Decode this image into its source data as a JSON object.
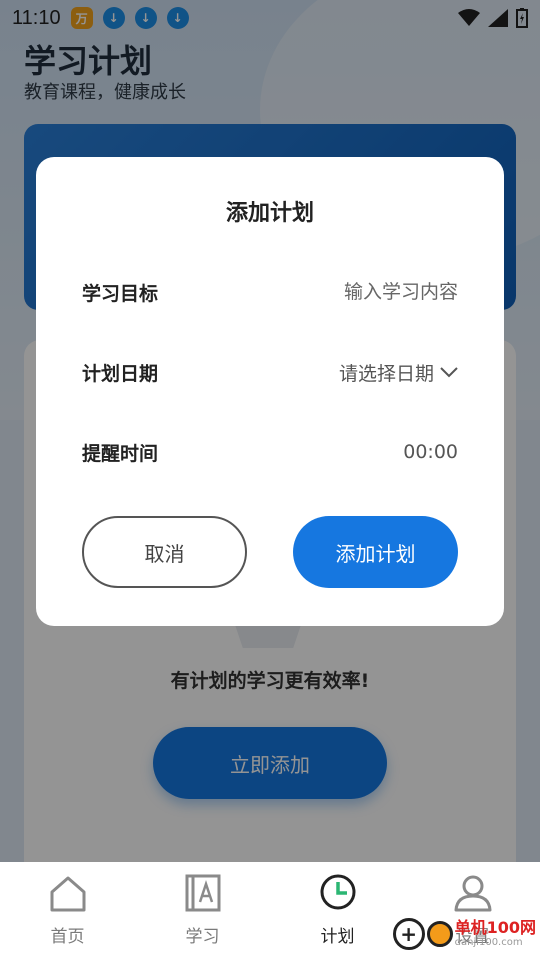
{
  "status_bar": {
    "time": "11:10",
    "wan_badge": "万"
  },
  "header": {
    "title": "学习计划",
    "subtitle": "教育课程，健康成长"
  },
  "empty_state": {
    "message": "有计划的学习更有效率!",
    "add_now_label": "立即添加"
  },
  "dialog": {
    "title": "添加计划",
    "fields": [
      {
        "label": "学习目标",
        "placeholder": "输入学习内容"
      },
      {
        "label": "计划日期",
        "value": "请选择日期"
      },
      {
        "label": "提醒时间",
        "value": "00:00"
      }
    ],
    "cancel_label": "取消",
    "confirm_label": "添加计划"
  },
  "nav": [
    {
      "label": "首页",
      "icon": "home-icon"
    },
    {
      "label": "学习",
      "icon": "study-icon"
    },
    {
      "label": "计划",
      "icon": "clock-icon",
      "active": true
    },
    {
      "label": "设置",
      "icon": "user-icon"
    }
  ],
  "watermark": {
    "text": "单机100网",
    "url": "danji100.com"
  },
  "colors": {
    "primary": "#1677e0",
    "overlay": "rgba(0,0,0,0.42)"
  }
}
